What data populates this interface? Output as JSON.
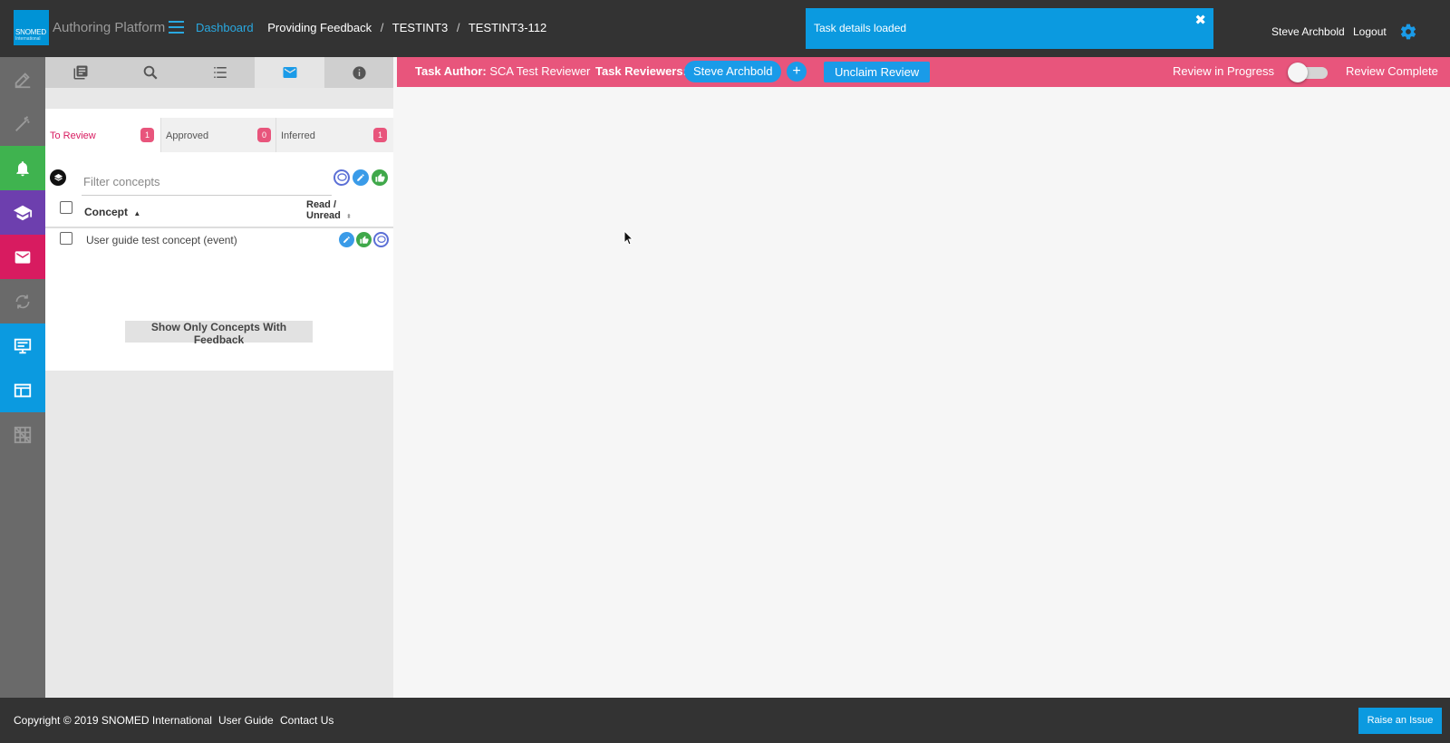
{
  "header": {
    "logo_text": "SNOMED",
    "logo_subtext": "International",
    "app_title": "Authoring Platform",
    "breadcrumb": {
      "dashboard": "Dashboard",
      "project": "Providing Feedback",
      "sep": "/",
      "branch": "TESTINT3",
      "task": "TESTINT3-112"
    },
    "toast": {
      "message": "Task details loaded",
      "close": "✖"
    },
    "user_name": "Steve Archbold",
    "logout": "Logout"
  },
  "left_nav": [
    {
      "icon": "edit-icon",
      "color": "#6a6a6a"
    },
    {
      "icon": "magic-wand-icon",
      "color": "#6a6a6a"
    },
    {
      "icon": "bell-icon",
      "color": "#3fb34f"
    },
    {
      "icon": "graduation-cap-icon",
      "color": "#6d3fae"
    },
    {
      "icon": "envelope-icon",
      "color": "#d81b60"
    },
    {
      "icon": "sync-icon",
      "color": "#6a6a6a"
    },
    {
      "icon": "monitor-icon",
      "color": "#0b9ae0"
    },
    {
      "icon": "window-icon",
      "color": "#0b9ae0"
    },
    {
      "icon": "grid-off-icon",
      "color": "#6a6a6a"
    }
  ],
  "sidebar": {
    "tabs": [
      "book-icon",
      "search-icon",
      "list-icon",
      "envelope-icon",
      "info-icon"
    ],
    "filter_tabs": [
      {
        "label": "To Review",
        "count": "1"
      },
      {
        "label": "Approved",
        "count": "0"
      },
      {
        "label": "Inferred",
        "count": "1"
      }
    ],
    "filter_placeholder": "Filter concepts",
    "table": {
      "col_concept": "Concept",
      "col_read_1": "Read /",
      "col_read_2": "Unread",
      "rows": [
        {
          "concept": "User guide test concept (event)"
        }
      ]
    },
    "feedback_button": "Show Only Concepts With Feedback"
  },
  "taskbar": {
    "author_label": "Task Author:",
    "author_value": "SCA Test Reviewer",
    "reviewers_label": "Task Reviewers:",
    "reviewer": "Steve Archbold",
    "add": "+",
    "unclaim": "Unclaim Review",
    "review_in_progress": "Review in Progress",
    "review_complete": "Review Complete",
    "review_complete_toggle": false
  },
  "footer": {
    "copyright": "Copyright © 2019 SNOMED International",
    "user_guide": "User Guide",
    "contact": "Contact Us",
    "raise_issue": "Raise an Issue"
  },
  "colors": {
    "header_bg": "#333333",
    "accent_blue": "#0b9ae0",
    "taskbar_pink": "#e8557c",
    "badge_pink": "#e8557c"
  }
}
